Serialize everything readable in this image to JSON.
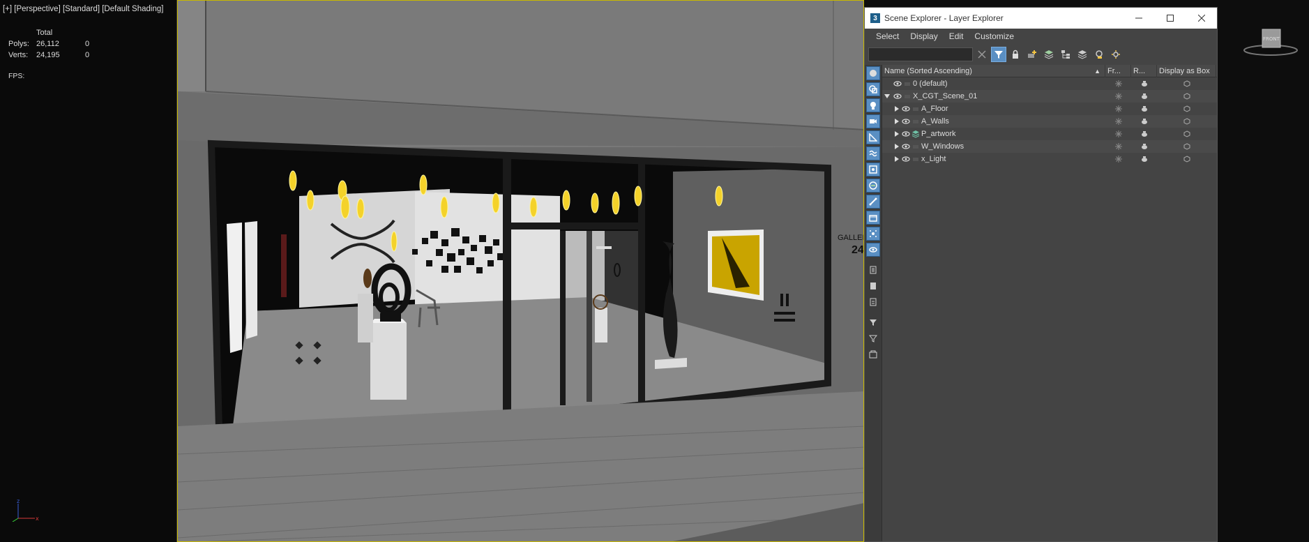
{
  "viewport_left": {
    "label": "[+] [Perspective] [Standard] [Default Shading]",
    "stats": {
      "header": "Total",
      "polys_label": "Polys:",
      "polys_total": "26,112",
      "polys_sel": "0",
      "verts_label": "Verts:",
      "verts_total": "24,195",
      "verts_sel": "0"
    },
    "fps_label": "FPS:",
    "axis": {
      "z": "z",
      "x": "x"
    }
  },
  "viewport_main": {
    "sign_text": "GALLER",
    "sign_num": "24",
    "accent_border": "#c8b800"
  },
  "view_cube": {
    "label": "FRONT"
  },
  "scene_explorer": {
    "title": "Scene Explorer - Layer Explorer",
    "menu": [
      "Select",
      "Display",
      "Edit",
      "Customize"
    ],
    "search_placeholder": "",
    "columns": {
      "name": "Name (Sorted Ascending)",
      "sort_arrow": "▲",
      "frozen": "Fr...",
      "renderable": "R...",
      "display_as_box": "Display as Box"
    },
    "rows": [
      {
        "name": "0 (default)"
      },
      {
        "name": "X_CGT_Scene_01"
      },
      {
        "name": "A_Floor"
      },
      {
        "name": "A_Walls"
      },
      {
        "name": "P_artwork"
      },
      {
        "name": "W_Windows"
      },
      {
        "name": "x_Light"
      }
    ],
    "colors": {
      "active_button": "#5a8fc3",
      "panel": "#444444"
    }
  }
}
